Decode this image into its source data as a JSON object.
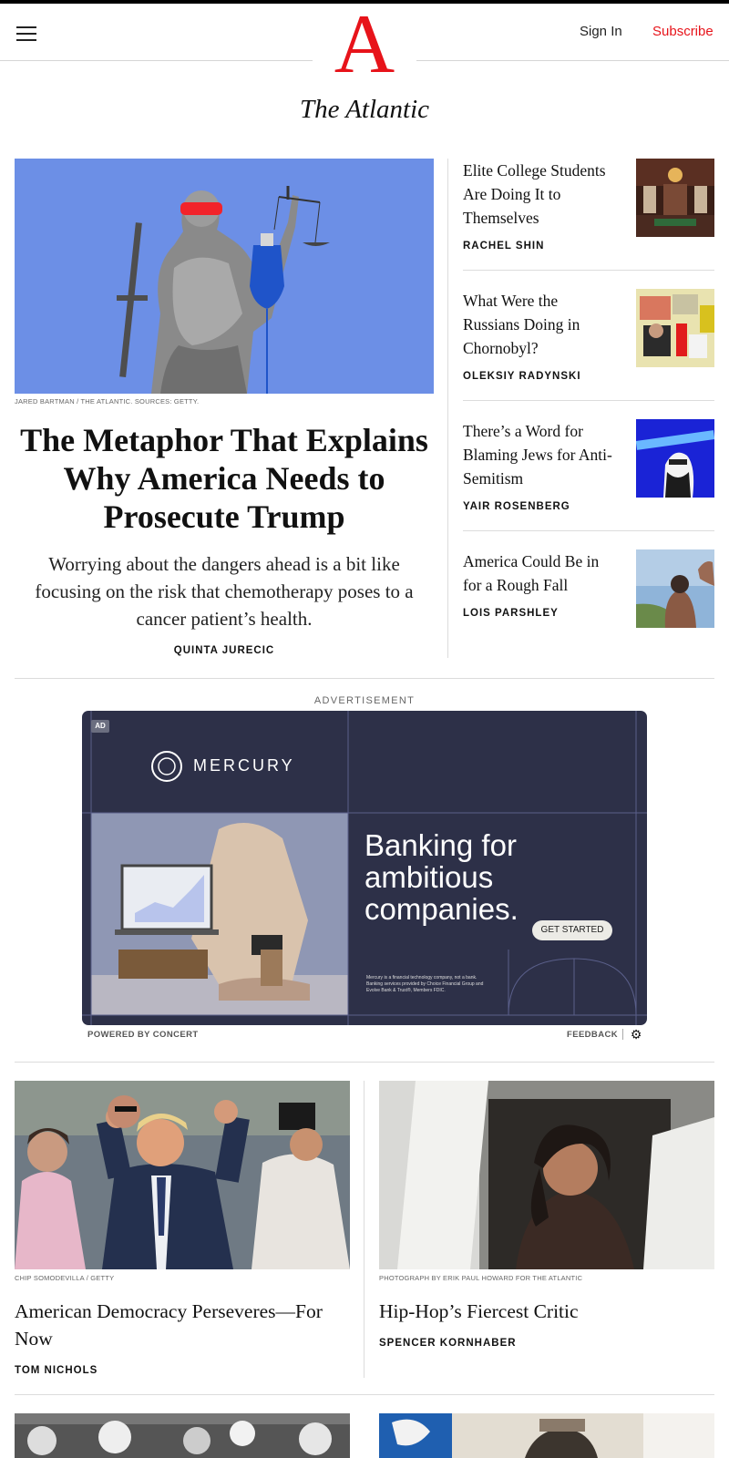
{
  "header": {
    "menu_label": "",
    "logo_letter": "A",
    "logo_text": "The Atlantic",
    "sign_in": "Sign In",
    "subscribe": "Subscribe"
  },
  "lead": {
    "image_credit": "JARED BARTMAN / THE ATLANTIC. SOURCES: GETTY.",
    "title": "The Metaphor That Explains Why America Needs to Prosecute Trump",
    "dek": "Worrying about the dangers ahead is a bit like focusing on the risk that chemotherapy poses to a cancer patient’s health.",
    "byline": "QUINTA JURECIC"
  },
  "side_stories": [
    {
      "title": "Elite College Students Are Doing It to Themselves",
      "byline": "RACHEL SHIN"
    },
    {
      "title": "What Were the Russians Doing in Chornobyl?",
      "byline": "OLEKSIY RADYNSKI"
    },
    {
      "title": "There’s a Word for Blaming Jews for Anti-Semitism",
      "byline": "YAIR ROSENBERG"
    },
    {
      "title": "America Could Be in for a Rough Fall",
      "byline": "LOIS PARSHLEY"
    }
  ],
  "ad": {
    "label": "ADVERTISEMENT",
    "badge": "AD",
    "brand": "MERCURY",
    "headline": "Banking for ambitious companies.",
    "cta": "GET STARTED",
    "fine_print": "Mercury is a financial technology company, not a bank. Banking services provided by Choice Financial Group and Evolve Bank & Trust®, Members FDIC.",
    "powered_by": "POWERED BY CONCERT",
    "feedback": "FEEDBACK"
  },
  "cards": [
    {
      "image_credit": "CHIP SOMODEVILLA / GETTY",
      "title": "American Democracy Perseveres—For Now",
      "byline": "TOM NICHOLS"
    },
    {
      "image_credit": "PHOTOGRAPH BY ERIK PAUL HOWARD FOR THE ATLANTIC",
      "title": "Hip-Hop’s Fiercest Critic",
      "byline": "SPENCER KORNHABER"
    }
  ],
  "colors": {
    "brand_red": "#e7131a",
    "lead_image_bg": "#6c8fe6",
    "ad_bg": "#2d3048"
  }
}
